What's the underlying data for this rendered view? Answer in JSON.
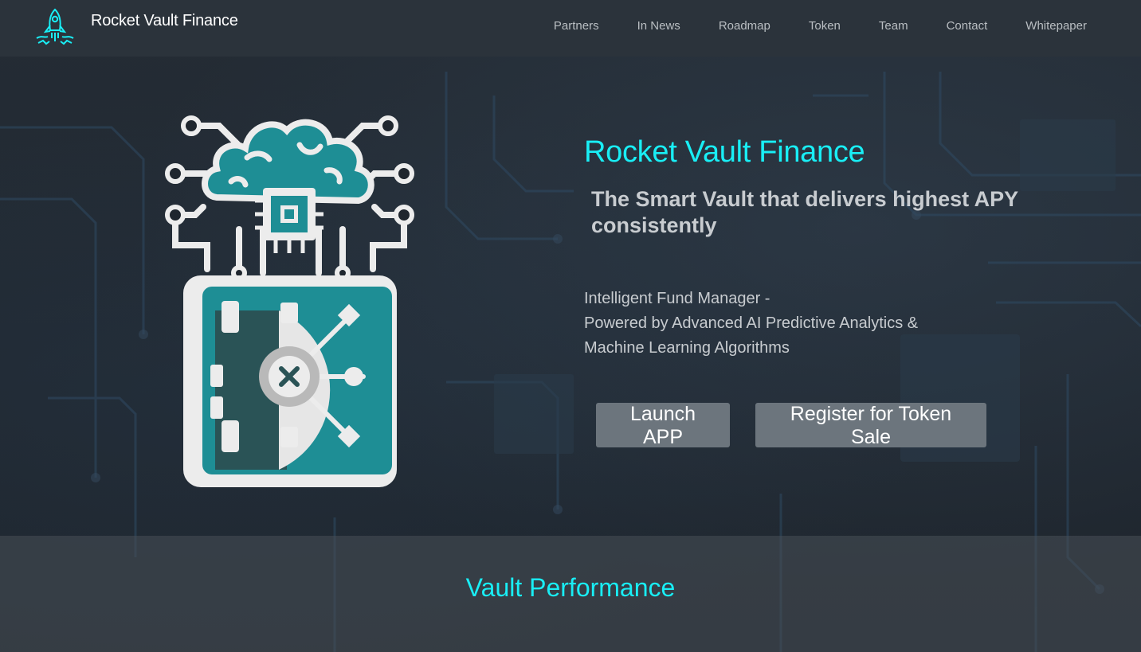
{
  "brand": {
    "name": "Rocket Vault Finance",
    "logo_icon": "rocket-icon",
    "accent_color": "#19eef5"
  },
  "nav": {
    "items": [
      {
        "label": "Partners"
      },
      {
        "label": "In News"
      },
      {
        "label": "Roadmap"
      },
      {
        "label": "Token"
      },
      {
        "label": "Team"
      },
      {
        "label": "Contact"
      },
      {
        "label": "Whitepaper"
      }
    ]
  },
  "hero": {
    "illustration_icon": "ai-brain-vault-icon",
    "title": "Rocket Vault Finance",
    "subtitle": "The Smart Vault that delivers highest APY consistently",
    "description_lines": [
      "Intelligent Fund Manager -",
      "Powered by Advanced AI Predictive Analytics &",
      "Machine Learning Algorithms"
    ],
    "buttons": {
      "launch": "Launch APP",
      "register": "Register for Token Sale"
    },
    "button_color": "#6c757d"
  },
  "performance": {
    "title": "Vault Performance"
  }
}
